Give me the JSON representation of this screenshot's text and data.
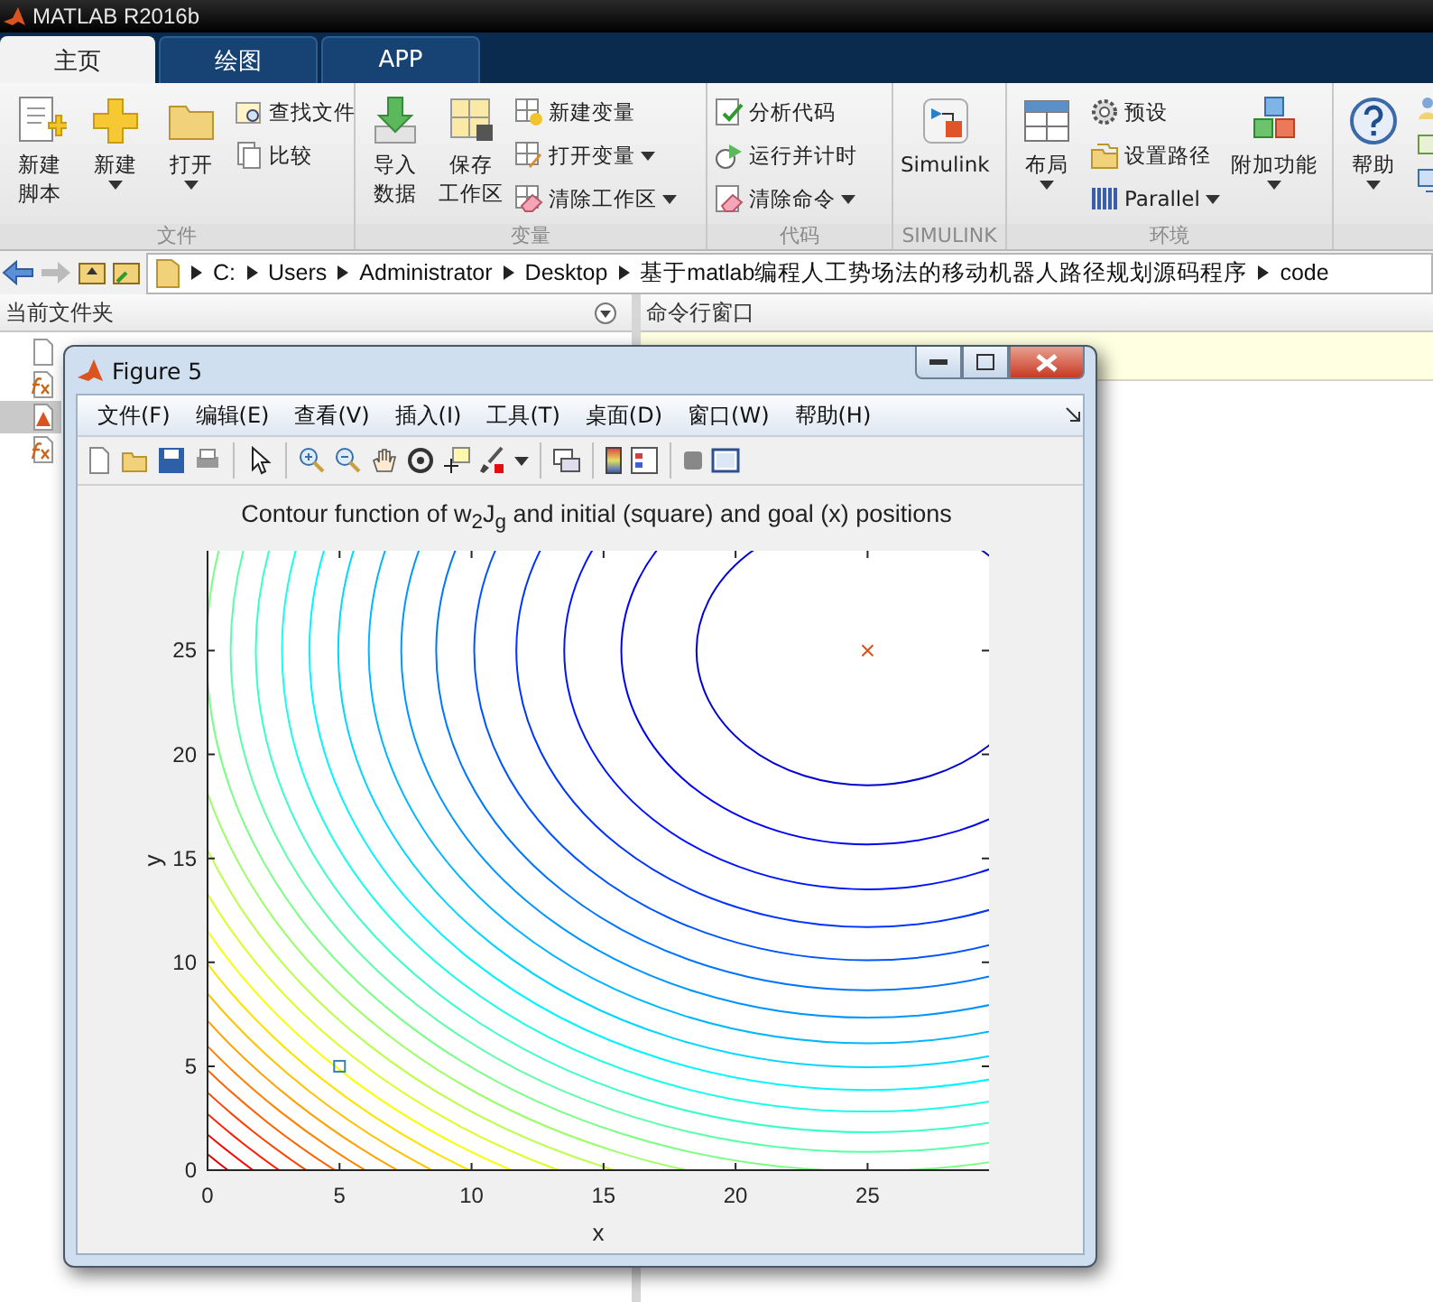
{
  "window": {
    "title": "MATLAB R2016b"
  },
  "tabs": [
    {
      "label": "主页",
      "selected": true
    },
    {
      "label": "绘图",
      "selected": false
    },
    {
      "label": "APP",
      "selected": false
    }
  ],
  "ribbon": {
    "groups": [
      {
        "label": "文件",
        "items": [
          {
            "kind": "large",
            "lines": [
              "新建",
              "脚本"
            ],
            "dropdown": false
          },
          {
            "kind": "large",
            "lines": [
              "新建"
            ],
            "dropdown": true
          },
          {
            "kind": "large",
            "lines": [
              "打开"
            ],
            "dropdown": true
          },
          {
            "kind": "stack",
            "buttons": [
              {
                "label": "查找文件",
                "dropdown": false
              },
              {
                "label": "比较",
                "dropdown": false
              }
            ]
          }
        ]
      },
      {
        "label": "变量",
        "items": [
          {
            "kind": "large",
            "lines": [
              "导入",
              "数据"
            ],
            "dropdown": false
          },
          {
            "kind": "large",
            "lines": [
              "保存",
              "工作区"
            ],
            "dropdown": false
          },
          {
            "kind": "stack",
            "buttons": [
              {
                "label": "新建变量",
                "dropdown": false
              },
              {
                "label": "打开变量",
                "dropdown": true
              },
              {
                "label": "清除工作区",
                "dropdown": true
              }
            ]
          }
        ]
      },
      {
        "label": "代码",
        "items": [
          {
            "kind": "stack",
            "buttons": [
              {
                "label": "分析代码",
                "dropdown": false
              },
              {
                "label": "运行并计时",
                "dropdown": false
              },
              {
                "label": "清除命令",
                "dropdown": true
              }
            ]
          }
        ]
      },
      {
        "label": "SIMULINK",
        "items": [
          {
            "kind": "large",
            "lines": [
              "Simulink"
            ],
            "dropdown": false
          }
        ]
      },
      {
        "label": "环境",
        "items": [
          {
            "kind": "large",
            "lines": [
              "布局"
            ],
            "dropdown": true
          },
          {
            "kind": "stack",
            "buttons": [
              {
                "label": "预设",
                "dropdown": false
              },
              {
                "label": "设置路径",
                "dropdown": false
              },
              {
                "label": "Parallel",
                "dropdown": true
              }
            ]
          },
          {
            "kind": "large",
            "lines": [
              "附加功能"
            ],
            "dropdown": true
          }
        ]
      },
      {
        "items": [
          {
            "kind": "large",
            "lines": [
              "帮助"
            ],
            "dropdown": true
          }
        ]
      }
    ]
  },
  "address_bar": {
    "path": [
      "C:",
      "Users",
      "Administrator",
      "Desktop",
      "基于matlab编程人工势场法的移动机器人路径规划源码程序",
      "code"
    ]
  },
  "current_folder": {
    "title": "当前文件夹",
    "files": [
      {
        "kind": "blank",
        "selected": false
      },
      {
        "kind": "function",
        "selected": false
      },
      {
        "kind": "figure",
        "selected": true
      },
      {
        "kind": "function",
        "selected": false
      }
    ]
  },
  "command_window": {
    "title": "命令行窗口"
  },
  "figure": {
    "title": "Figure 5",
    "menu": [
      "文件(F)",
      "编辑(E)",
      "查看(V)",
      "插入(I)",
      "工具(T)",
      "桌面(D)",
      "窗口(W)",
      "帮助(H)"
    ],
    "chart_data": {
      "type": "scatter",
      "title": "Contour function of w$_{2}$J$_{g}$ and initial (square) and goal (x) positions",
      "xlabel": "x",
      "ylabel": "y",
      "x": [
        5,
        25
      ],
      "series": [
        {
          "color": "#3a7fb0",
          "values": [
            5,
            null
          ]
        },
        {
          "color": "#d95319",
          "values": [
            null,
            25
          ]
        }
      ],
      "xlim": [
        0,
        29.6
      ],
      "ylim": [
        0,
        29.8
      ],
      "xticks": [
        0,
        5,
        10,
        15,
        20,
        25
      ],
      "yticks": [
        0,
        5,
        10,
        15,
        20,
        25
      ]
    }
  }
}
